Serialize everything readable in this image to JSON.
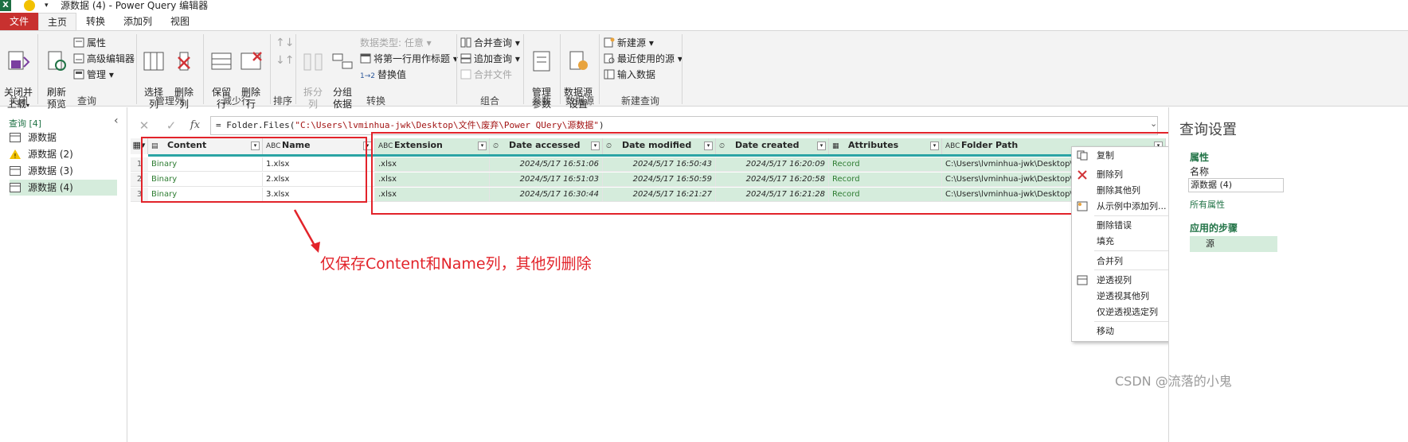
{
  "window": {
    "title": "源数据 (4) - Power Query 编辑器"
  },
  "tabs": [
    "文件",
    "主页",
    "转换",
    "添加列",
    "视图"
  ],
  "ribbon": {
    "close_apply": "关闭并\n上载",
    "refresh_preview": "刷新\n预览",
    "properties": "属性",
    "advanced_editor": "高级编辑器",
    "manage": "管理",
    "choose_columns": "选择\n列",
    "remove_columns": "删除\n列",
    "keep_rows": "保留\n行",
    "remove_rows": "删除\n行",
    "split_column": "拆分\n列",
    "group_by": "分组\n依据",
    "data_type": "数据类型: 任意",
    "first_row_header": "将第一行用作标题",
    "replace_values": "替换值",
    "merge_queries": "合并查询",
    "append_queries": "追加查询",
    "combine_files": "合并文件",
    "manage_params": "管理\n参数",
    "data_source_settings": "数据源\n设置",
    "new_source": "新建源",
    "recent_sources": "最近使用的源",
    "enter_data": "输入数据",
    "groups": {
      "close": "关闭",
      "query": "查询",
      "manage_columns": "管理列",
      "reduce_rows": "减少行",
      "sort": "排序",
      "transform": "转换",
      "combine": "组合",
      "params": "参数",
      "datasource": "数据源",
      "new_query": "新建查询"
    }
  },
  "queries": {
    "header": "查询 [4]",
    "items": [
      "源数据",
      "源数据 (2)",
      "源数据 (3)",
      "源数据 (4)"
    ]
  },
  "formula": {
    "prefix": "= Folder.Files(",
    "path": "\"C:\\Users\\lvminhua-jwk\\Desktop\\文件\\废弃\\Power QUery\\源数据\"",
    "suffix": ")"
  },
  "grid": {
    "columns": [
      "Content",
      "Name",
      "Extension",
      "Date accessed",
      "Date modified",
      "Date created",
      "Attributes",
      "Folder Path"
    ],
    "type_icons": [
      "▤",
      "ABC",
      "ABC",
      "⏲",
      "⏲",
      "⏲",
      "▦",
      "ABC"
    ],
    "rows": [
      [
        "1",
        "Binary",
        "1.xlsx",
        ".xlsx",
        "2024/5/17 16:51:06",
        "2024/5/17 16:50:43",
        "2024/5/17 16:20:09",
        "Record",
        "C:\\Users\\lvminhua-jwk\\Desktop\\文件"
      ],
      [
        "2",
        "Binary",
        "2.xlsx",
        ".xlsx",
        "2024/5/17 16:51:03",
        "2024/5/17 16:50:59",
        "2024/5/17 16:20:58",
        "Record",
        "C:\\Users\\lvminhua-jwk\\Desktop\\文件"
      ],
      [
        "3",
        "Binary",
        "3.xlsx",
        ".xlsx",
        "2024/5/17 16:30:44",
        "2024/5/17 16:21:27",
        "2024/5/17 16:21:28",
        "Record",
        "C:\\Users\\lvminhua-jwk\\Desktop\\文件"
      ]
    ]
  },
  "context_menu": [
    "复制",
    "删除列",
    "删除其他列",
    "从示例中添加列...",
    "删除错误",
    "填充",
    "合并列",
    "逆透视列",
    "逆透视其他列",
    "仅逆透视选定列",
    "移动"
  ],
  "right_panel": {
    "title": "查询设置",
    "props_header": "属性",
    "name_label": "名称",
    "name_value": "源数据 (4)",
    "all_props": "所有属性",
    "steps_header": "应用的步骤",
    "step": "源"
  },
  "annotation": "仅保存Content和Name列，其他列删除",
  "watermark": "CSDN @流落的小鬼",
  "colors": {
    "accent_green": "#217346",
    "selected_bg": "#d5ecdc",
    "file_tab": "#c8312f",
    "annotation_red": "#e2232a"
  }
}
